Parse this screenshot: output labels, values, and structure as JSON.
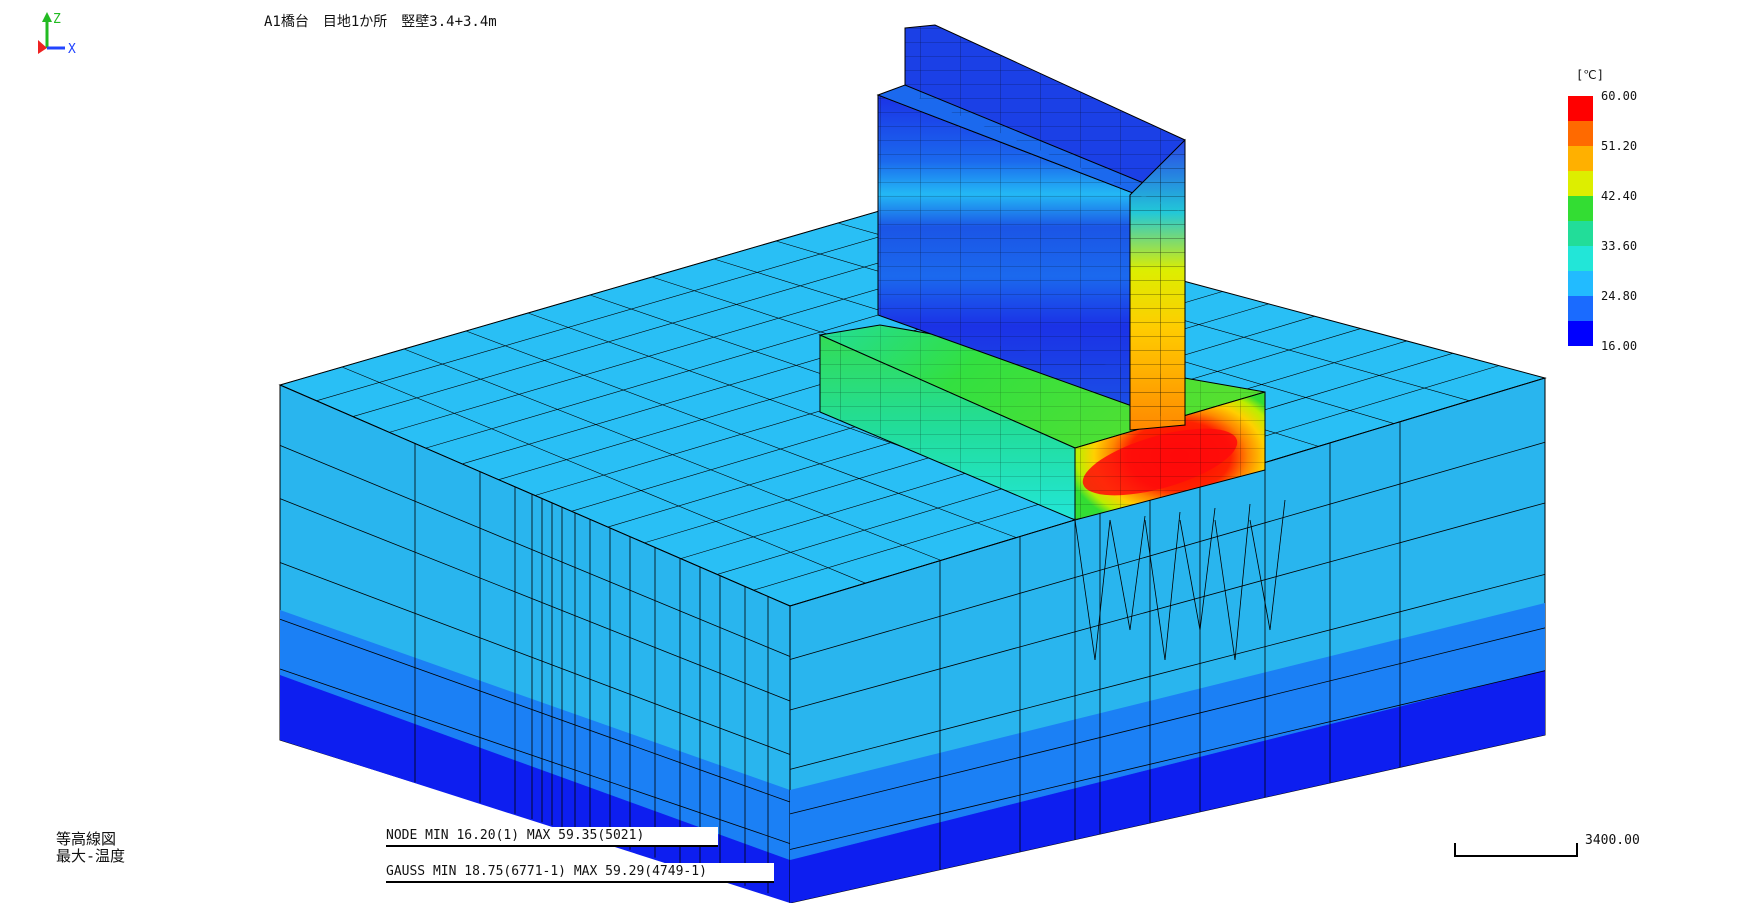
{
  "title": "A1橋台　目地1か所　竪壁3.4+3.4m",
  "axis": {
    "z_label": "Z",
    "x_label": "X"
  },
  "plot_type": {
    "line1": "等高線図",
    "line2": "最大-温度"
  },
  "stats": {
    "node": "NODE  MIN 16.20(1)    MAX 59.35(5021)",
    "gauss": "GAUSS MIN 18.75(6771-1)  MAX 59.29(4749-1)"
  },
  "scale_bar": {
    "value": "3400.00"
  },
  "legend": {
    "unit": "[℃]",
    "ticks": [
      "60.00",
      "51.20",
      "42.40",
      "33.60",
      "24.80",
      "16.00"
    ],
    "colors": [
      "#ff0000",
      "#ff6a00",
      "#ffb000",
      "#ddee00",
      "#33dd33",
      "#22dd99",
      "#22e6d8",
      "#22bbff",
      "#1a6bff",
      "#0000ff"
    ]
  },
  "colors": {
    "surface_top": "#29bff5",
    "surface_side": "#29b5ee",
    "deep_mid": "#1b80f5",
    "deep": "#0d1ef0",
    "wall_dark": "#1a2ee0",
    "wall_mid": "#1a5fe8",
    "hot": "#ff1010",
    "warm": "#ffae00",
    "green": "#22e040"
  }
}
